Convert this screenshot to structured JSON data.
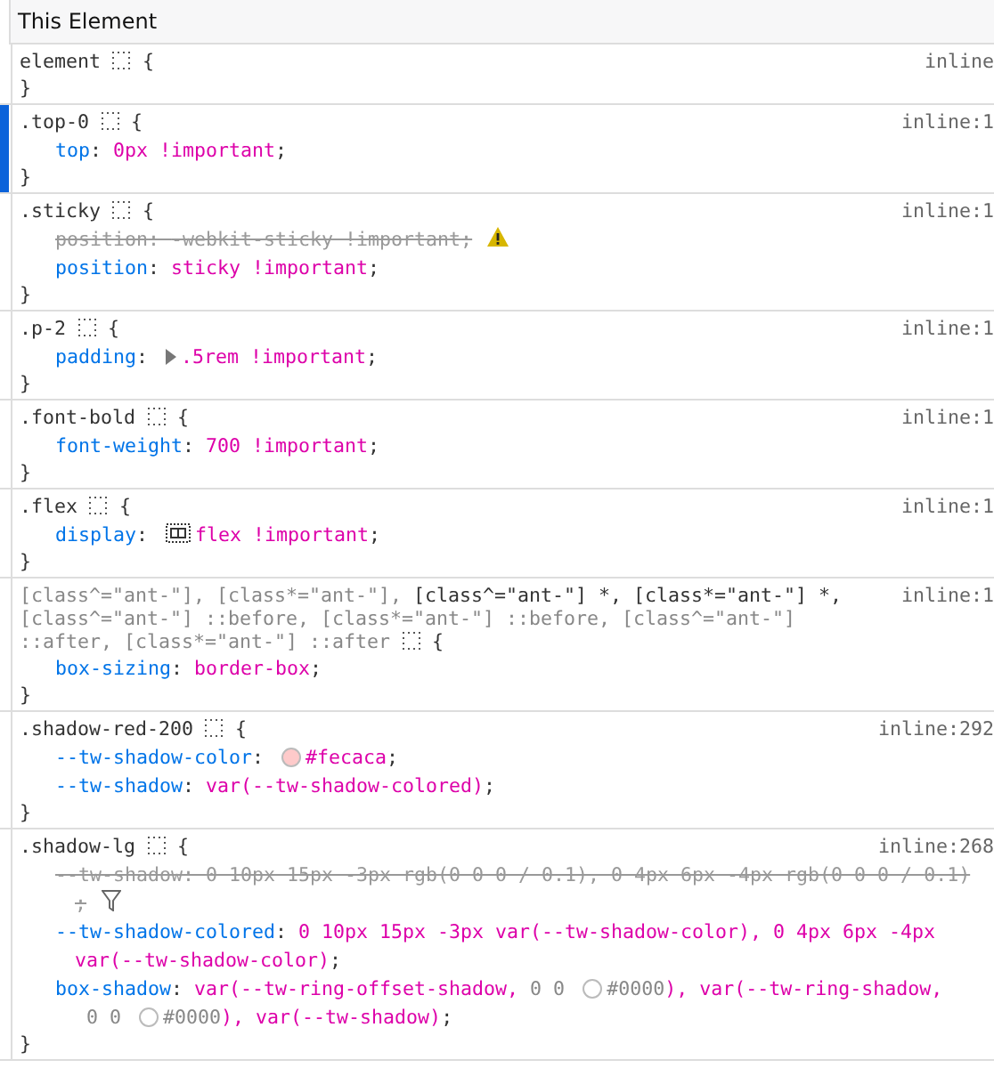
{
  "panel": {
    "title": "This Element"
  },
  "rules": [
    {
      "selector": [
        {
          "text": "element",
          "matched": true
        }
      ],
      "source": "inline",
      "open": "{",
      "close": "}",
      "highlighted": false
    },
    {
      "selector": [
        {
          "text": ".top-0",
          "matched": true
        }
      ],
      "source": "inline:1",
      "open": "{",
      "close": "}",
      "highlighted": true,
      "declarations": [
        {
          "overridden": false,
          "tokens": [
            {
              "kind": "prop",
              "text": "top"
            },
            {
              "kind": "punct",
              "text": ": "
            },
            {
              "kind": "value",
              "text": "0px !important"
            },
            {
              "kind": "punct",
              "text": ";"
            }
          ]
        }
      ]
    },
    {
      "selector": [
        {
          "text": ".sticky",
          "matched": true
        }
      ],
      "source": "inline:1",
      "open": "{",
      "close": "}",
      "highlighted": false,
      "declarations": [
        {
          "overridden": true,
          "tokens": [
            {
              "kind": "prop",
              "text": "position"
            },
            {
              "kind": "punct",
              "text": ": "
            },
            {
              "kind": "value",
              "text": "-webkit-sticky !important"
            },
            {
              "kind": "punct",
              "text": ";"
            },
            {
              "kind": "warning"
            }
          ]
        },
        {
          "overridden": false,
          "tokens": [
            {
              "kind": "prop",
              "text": "position"
            },
            {
              "kind": "punct",
              "text": ": "
            },
            {
              "kind": "value",
              "text": "sticky !important"
            },
            {
              "kind": "punct",
              "text": ";"
            }
          ]
        }
      ]
    },
    {
      "selector": [
        {
          "text": ".p-2",
          "matched": true
        }
      ],
      "source": "inline:1",
      "open": "{",
      "close": "}",
      "highlighted": false,
      "declarations": [
        {
          "overridden": false,
          "tokens": [
            {
              "kind": "prop",
              "text": "padding"
            },
            {
              "kind": "punct",
              "text": ": "
            },
            {
              "kind": "expander"
            },
            {
              "kind": "value",
              "text": ".5rem !important"
            },
            {
              "kind": "punct",
              "text": ";"
            }
          ]
        }
      ]
    },
    {
      "selector": [
        {
          "text": ".font-bold",
          "matched": true
        }
      ],
      "source": "inline:1",
      "open": "{",
      "close": "}",
      "highlighted": false,
      "declarations": [
        {
          "overridden": false,
          "tokens": [
            {
              "kind": "prop",
              "text": "font-weight"
            },
            {
              "kind": "punct",
              "text": ": "
            },
            {
              "kind": "value",
              "text": "700 !important"
            },
            {
              "kind": "punct",
              "text": ";"
            }
          ]
        }
      ]
    },
    {
      "selector": [
        {
          "text": ".flex",
          "matched": true
        }
      ],
      "source": "inline:1",
      "open": "{",
      "close": "}",
      "highlighted": false,
      "declarations": [
        {
          "overridden": false,
          "tokens": [
            {
              "kind": "prop",
              "text": "display"
            },
            {
              "kind": "punct",
              "text": ": "
            },
            {
              "kind": "flex"
            },
            {
              "kind": "value",
              "text": "flex !important"
            },
            {
              "kind": "punct",
              "text": ";"
            }
          ]
        }
      ]
    },
    {
      "selector": [
        {
          "text": "[class^=\"ant-\"], [class*=\"ant-\"],",
          "matched": false
        },
        {
          "text": "[class^=\"ant-\"] *, [class*=\"ant-\"] *,",
          "matched": true
        },
        {
          "text": "[class^=\"ant-\"] ::before, [class*=\"ant-\"] ::before, [class^=\"ant-\"]",
          "matched": false
        },
        {
          "text": "::after, [class*=\"ant-\"] ::after",
          "matched": false
        }
      ],
      "source": "inline:1",
      "open": "{",
      "close": "}",
      "highlighted": false,
      "declarations": [
        {
          "overridden": false,
          "tokens": [
            {
              "kind": "prop",
              "text": "box-sizing"
            },
            {
              "kind": "punct",
              "text": ": "
            },
            {
              "kind": "value",
              "text": "border-box"
            },
            {
              "kind": "punct",
              "text": ";"
            }
          ]
        }
      ]
    },
    {
      "selector": [
        {
          "text": ".shadow-red-200",
          "matched": true
        }
      ],
      "source": "inline:292",
      "open": "{",
      "close": "}",
      "highlighted": false,
      "declarations": [
        {
          "overridden": false,
          "tokens": [
            {
              "kind": "prop",
              "text": "--tw-shadow-color"
            },
            {
              "kind": "punct",
              "text": ": "
            },
            {
              "kind": "swatch",
              "color": "#fecaca"
            },
            {
              "kind": "value",
              "text": "#fecaca"
            },
            {
              "kind": "punct",
              "text": ";"
            }
          ]
        },
        {
          "overridden": false,
          "tokens": [
            {
              "kind": "prop",
              "text": "--tw-shadow"
            },
            {
              "kind": "punct",
              "text": ": "
            },
            {
              "kind": "value",
              "text": "var(--tw-shadow-colored)"
            },
            {
              "kind": "punct",
              "text": ";"
            }
          ]
        }
      ]
    },
    {
      "selector": [
        {
          "text": ".shadow-lg",
          "matched": true
        }
      ],
      "source": "inline:268",
      "open": "{",
      "close": "}",
      "highlighted": false,
      "declarations": [
        {
          "overridden": true,
          "tokens": [
            {
              "kind": "prop",
              "text": "--tw-shadow"
            },
            {
              "kind": "punct",
              "text": ": "
            },
            {
              "kind": "value",
              "text": "0 10px 15px -3px rgb(0 0 0 / 0.1), 0 4px 6px -4px rgb(0 0 0 / "
            },
            {
              "kind": "value",
              "text": "0.1)"
            },
            {
              "kind": "punct",
              "text": ";"
            },
            {
              "kind": "filter"
            }
          ]
        },
        {
          "overridden": false,
          "tokens": [
            {
              "kind": "prop",
              "text": "--tw-shadow-colored"
            },
            {
              "kind": "punct",
              "text": ": "
            },
            {
              "kind": "value",
              "text": "0 10px 15px -3px var(--tw-shadow-color), 0 4px 6px -4px "
            },
            {
              "kind": "value",
              "text": "var(--tw-shadow-color)"
            },
            {
              "kind": "punct",
              "text": ";"
            }
          ]
        },
        {
          "overridden": false,
          "tokens": [
            {
              "kind": "prop",
              "text": "box-shadow"
            },
            {
              "kind": "punct",
              "text": ": "
            },
            {
              "kind": "value",
              "text": "var(--tw-ring-offset-shadow,"
            },
            {
              "kind": "dim",
              "text": " 0 0 "
            },
            {
              "kind": "swatch",
              "color": "#ffffff"
            },
            {
              "kind": "dim",
              "text": "#0000"
            },
            {
              "kind": "value",
              "text": "), var(--tw-ring-shadow,"
            },
            {
              "kind": "dim",
              "text": " 0 "
            },
            {
              "kind": "dim",
              "text": "0 "
            },
            {
              "kind": "swatch",
              "color": "#ffffff"
            },
            {
              "kind": "dim",
              "text": "#0000"
            },
            {
              "kind": "value",
              "text": "), var(--tw-shadow)"
            },
            {
              "kind": "punct",
              "text": ";"
            }
          ]
        }
      ]
    }
  ]
}
